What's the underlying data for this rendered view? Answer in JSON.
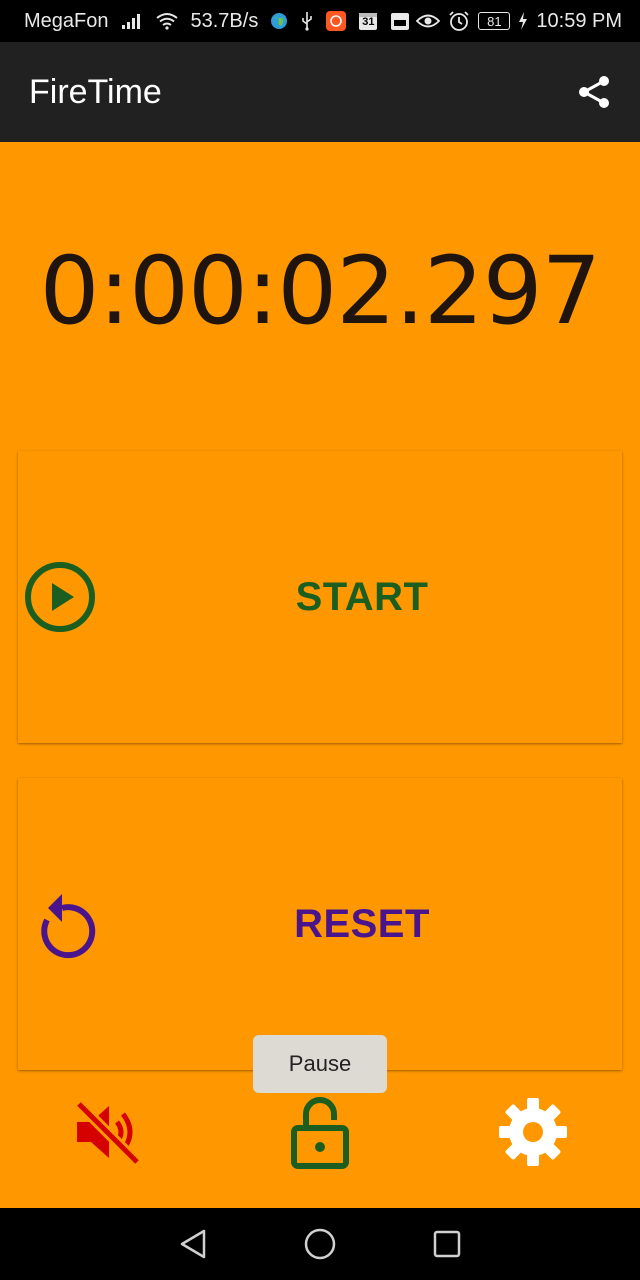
{
  "status_bar": {
    "carrier": "MegaFon",
    "speed": "53.7B/s",
    "calendar_day": "31",
    "battery": "81",
    "time": "10:59 PM",
    "icons": [
      "signal-icon",
      "wifi-icon",
      "globe-icon",
      "usb-icon",
      "app-notification-icon",
      "calendar-icon",
      "calendar-alt-icon",
      "eye-icon",
      "alarm-icon",
      "battery-icon",
      "charging-icon"
    ]
  },
  "app_bar": {
    "title": "FireTime",
    "share_icon": "share-icon"
  },
  "timer": {
    "display": "0:00:02.297"
  },
  "buttons": {
    "start_label": "START",
    "start_icon": "play-circle-icon",
    "start_color": "#1b5e20",
    "reset_label": "RESET",
    "reset_icon": "reset-icon",
    "reset_color": "#4a148c"
  },
  "toast": {
    "text": "Pause"
  },
  "toolbar": {
    "mute_icon": "volume-off-icon",
    "mute_color": "#d50000",
    "lock_icon": "lock-open-icon",
    "lock_color": "#1b5e20",
    "settings_icon": "gear-icon",
    "settings_color": "#ffffff"
  },
  "nav": {
    "items": [
      "back-icon",
      "home-icon",
      "recents-icon"
    ]
  },
  "colors": {
    "background": "#ff9800",
    "app_bar": "#212121"
  }
}
